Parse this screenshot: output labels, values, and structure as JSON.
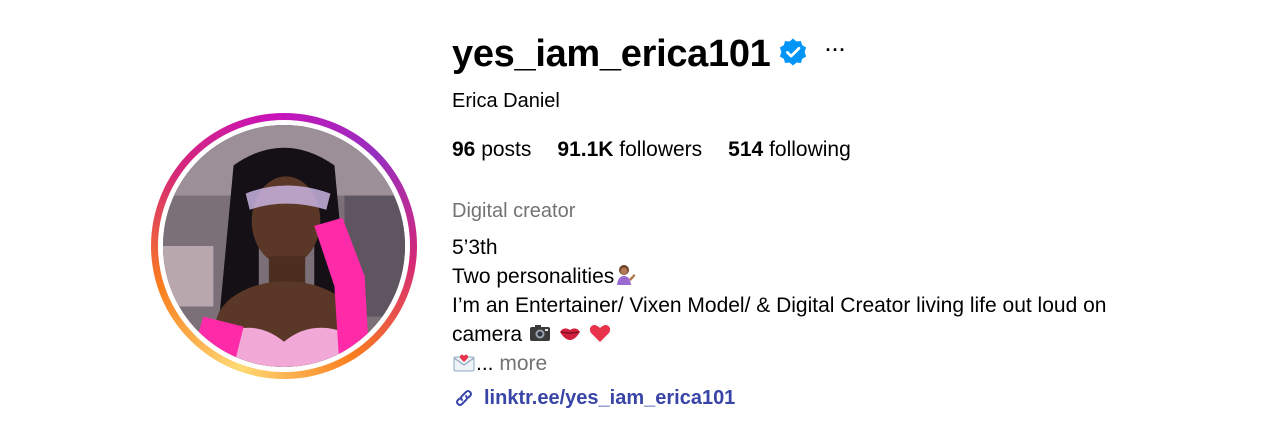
{
  "profile": {
    "username": "yes_iam_erica101",
    "full_name": "Erica Daniel",
    "verified": true,
    "more_label": "···",
    "avatar_alt": "profile-photo"
  },
  "stats": {
    "posts_count": "96",
    "posts_label": "posts",
    "followers_count": "91.1K",
    "followers_label": "followers",
    "following_count": "514",
    "following_label": "following"
  },
  "bio": {
    "category": "Digital creator",
    "line1": "5’3th",
    "line2": "Two personalities",
    "line3": "I’m an Entertainer/ Vixen Model/ & Digital Creator living life out loud on",
    "line4": "camera",
    "line5_prefix": "...",
    "more_label": "more"
  },
  "link": {
    "url_text": "linktr.ee/yes_iam_erica101"
  },
  "colors": {
    "verified_blue": "#0095f6",
    "link_color": "#3945a6",
    "secondary_text": "#737373"
  }
}
